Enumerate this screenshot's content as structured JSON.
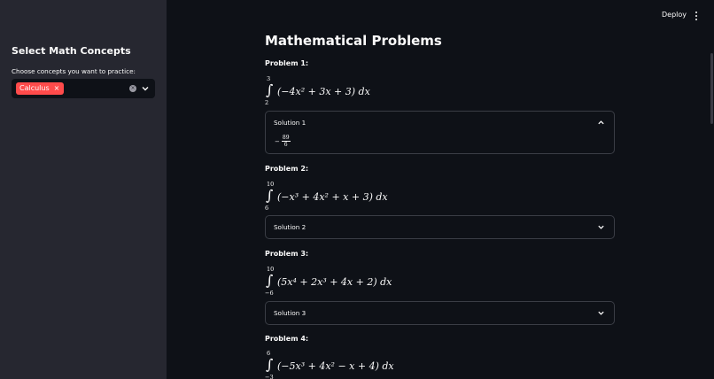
{
  "header": {
    "deploy_label": "Deploy",
    "menu_icon": "kebab-menu-icon"
  },
  "sidebar": {
    "title": "Select Math Concepts",
    "prompt": "Choose concepts you want to practice:",
    "selected_tags": [
      "Calculus"
    ],
    "tag_remove_glyph": "×",
    "clear_glyph": "×"
  },
  "main": {
    "title": "Mathematical Problems",
    "problems": [
      {
        "label": "Problem 1:",
        "upper": "3",
        "lower": "2",
        "integrand": "(−4x² + 3x + 3) dx",
        "solution": {
          "label": "Solution 1",
          "expanded": true,
          "sign": "−",
          "numerator": "89",
          "denominator": "6"
        }
      },
      {
        "label": "Problem 2:",
        "upper": "10",
        "lower": "6",
        "integrand": "(−x³ + 4x² + x + 3) dx",
        "solution": {
          "label": "Solution 2",
          "expanded": false
        }
      },
      {
        "label": "Problem 3:",
        "upper": "10",
        "lower": "−6",
        "integrand": "(5x⁴ + 2x³ + 4x + 2) dx",
        "solution": {
          "label": "Solution 3",
          "expanded": false
        }
      },
      {
        "label": "Problem 4:",
        "upper": "6",
        "lower": "−3",
        "integrand": "(−5x³ + 4x² − x + 4) dx"
      }
    ]
  },
  "integral_glyph": "∫",
  "colors": {
    "app_bg": "#0e1117",
    "sidebar_bg": "#262730",
    "accent": "#ff4b4b",
    "text": "#fafafa",
    "border": "#3a3d45"
  }
}
